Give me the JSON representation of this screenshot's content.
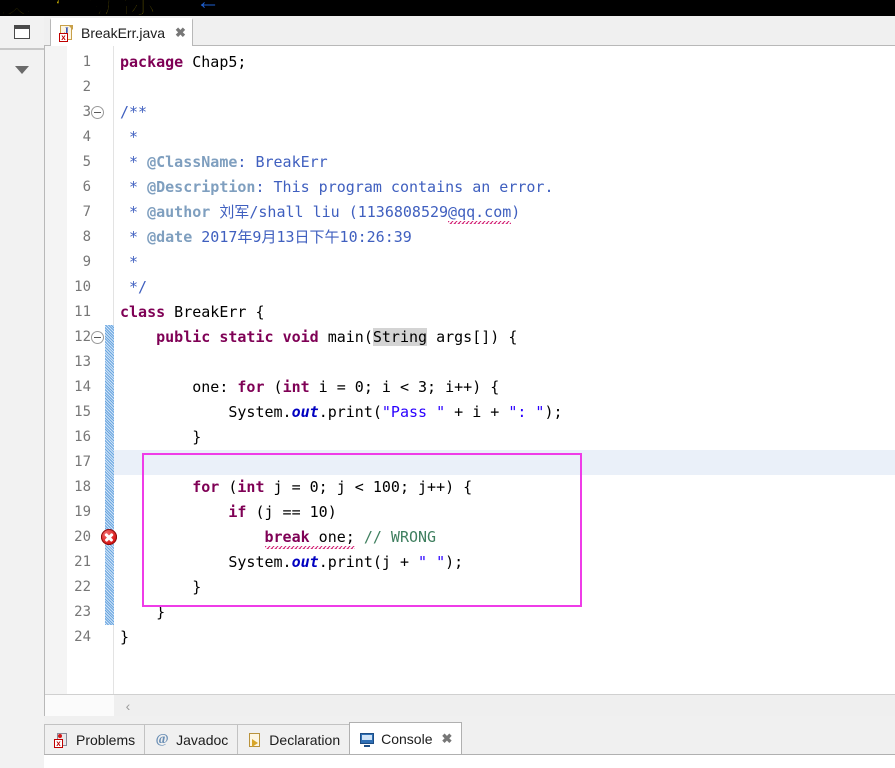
{
  "banner": {
    "text": "汉编程的启示",
    "arrow": "←"
  },
  "left_rail": {
    "restore_icon": "restore-view-icon",
    "menu_icon": "chevron-down-icon"
  },
  "editor": {
    "tab": {
      "label": "BreakErr.java",
      "close": "✖",
      "icon": "java-file-error-icon"
    },
    "scroll_left_arrow": "‹",
    "current_line": 17,
    "error_line": 20,
    "change_bar_from": 12,
    "change_bar_to": 23,
    "highlight_box_color": "#ef3ce8",
    "lines": [
      {
        "n": 1,
        "fold": false,
        "html": "<span class=\"kw\">package</span> Chap5;"
      },
      {
        "n": 2,
        "fold": false,
        "html": ""
      },
      {
        "n": 3,
        "fold": true,
        "html": "<span class=\"cmt\">/**</span>"
      },
      {
        "n": 4,
        "fold": false,
        "html": " <span class=\"cmt\">*</span>"
      },
      {
        "n": 5,
        "fold": false,
        "html": " <span class=\"cmt\">* </span><span class=\"ann\">@ClassName</span><span class=\"cmt\">: BreakErr</span>"
      },
      {
        "n": 6,
        "fold": false,
        "html": " <span class=\"cmt\">* </span><span class=\"ann\">@Description</span><span class=\"cmt\">: This program contains an error.</span>"
      },
      {
        "n": 7,
        "fold": false,
        "html": " <span class=\"cmt\">* </span><span class=\"ann\">@author</span><span class=\"cmt\"> <span class=\"cn-char\">刘军</span>/shall liu (1136808529<span class=\"squig\">@qq.com</span>)</span>"
      },
      {
        "n": 8,
        "fold": false,
        "html": " <span class=\"cmt\">* </span><span class=\"ann\">@date</span><span class=\"cmt\"> 2017<span class=\"cn-char\">年</span>9<span class=\"cn-char\">月</span>13<span class=\"cn-char\">日下午</span>10:26:39</span>"
      },
      {
        "n": 9,
        "fold": false,
        "html": " <span class=\"cmt\">*</span>"
      },
      {
        "n": 10,
        "fold": false,
        "html": " <span class=\"cmt\">*/</span>"
      },
      {
        "n": 11,
        "fold": false,
        "html": "<span class=\"kw\">class</span> BreakErr {"
      },
      {
        "n": 12,
        "fold": true,
        "html": "    <span class=\"kw\">public</span> <span class=\"kw\">static</span> <span class=\"kw\">void</span> main(<span class=\"occ\">String</span> args[]) {"
      },
      {
        "n": 13,
        "fold": false,
        "html": ""
      },
      {
        "n": 14,
        "fold": false,
        "html": "        one: <span class=\"kw\">for</span> (<span class=\"kw\">int</span> i = 0; i &lt; 3; i++) {"
      },
      {
        "n": 15,
        "fold": false,
        "html": "            System.<span class=\"fld\">out</span>.print(<span class=\"str\">\"Pass \"</span> + i + <span class=\"str\">\": \"</span>);"
      },
      {
        "n": 16,
        "fold": false,
        "html": "        }"
      },
      {
        "n": 17,
        "fold": false,
        "html": ""
      },
      {
        "n": 18,
        "fold": false,
        "html": "        <span class=\"kw\">for</span> (<span class=\"kw\">int</span> j = 0; j &lt; 100; j++) {"
      },
      {
        "n": 19,
        "fold": false,
        "html": "            <span class=\"kw\">if</span> (j == 10)"
      },
      {
        "n": 20,
        "fold": false,
        "html": "                <span class=\"squig\"><span class=\"kw\">break</span> one;</span> <span class=\"cmt-line\">// WRONG</span>"
      },
      {
        "n": 21,
        "fold": false,
        "html": "            System.<span class=\"fld\">out</span>.print(j + <span class=\"str\">\" \"</span>);"
      },
      {
        "n": 22,
        "fold": false,
        "html": "        }"
      },
      {
        "n": 23,
        "fold": false,
        "html": "    }"
      },
      {
        "n": 24,
        "fold": false,
        "html": "}"
      }
    ],
    "plain_lines": [
      "package Chap5;",
      "",
      "/**",
      " *",
      " * @ClassName: BreakErr",
      " * @Description: This program contains an error.",
      " * @author 刘军/shall liu (1136808529@qq.com)",
      " * @date 2017年9月13日下午10:26:39",
      " *",
      " */",
      "class BreakErr {",
      "    public static void main(String args[]) {",
      "",
      "        one: for (int i = 0; i < 3; i++) {",
      "            System.out.print(\"Pass \" + i + \": \");",
      "        }",
      "",
      "        for (int j = 0; j < 100; j++) {",
      "            if (j == 10)",
      "                break one; // WRONG",
      "            System.out.print(j + \" \");",
      "        }",
      "    }",
      "}"
    ]
  },
  "bottom_tabs": [
    {
      "label": "Problems",
      "icon": "problems-icon",
      "active": false,
      "close": ""
    },
    {
      "label": "Javadoc",
      "icon": "javadoc-at-icon",
      "active": false,
      "close": ""
    },
    {
      "label": "Declaration",
      "icon": "declaration-icon",
      "active": false,
      "close": ""
    },
    {
      "label": "Console",
      "icon": "console-icon",
      "active": true,
      "close": "✖"
    }
  ]
}
